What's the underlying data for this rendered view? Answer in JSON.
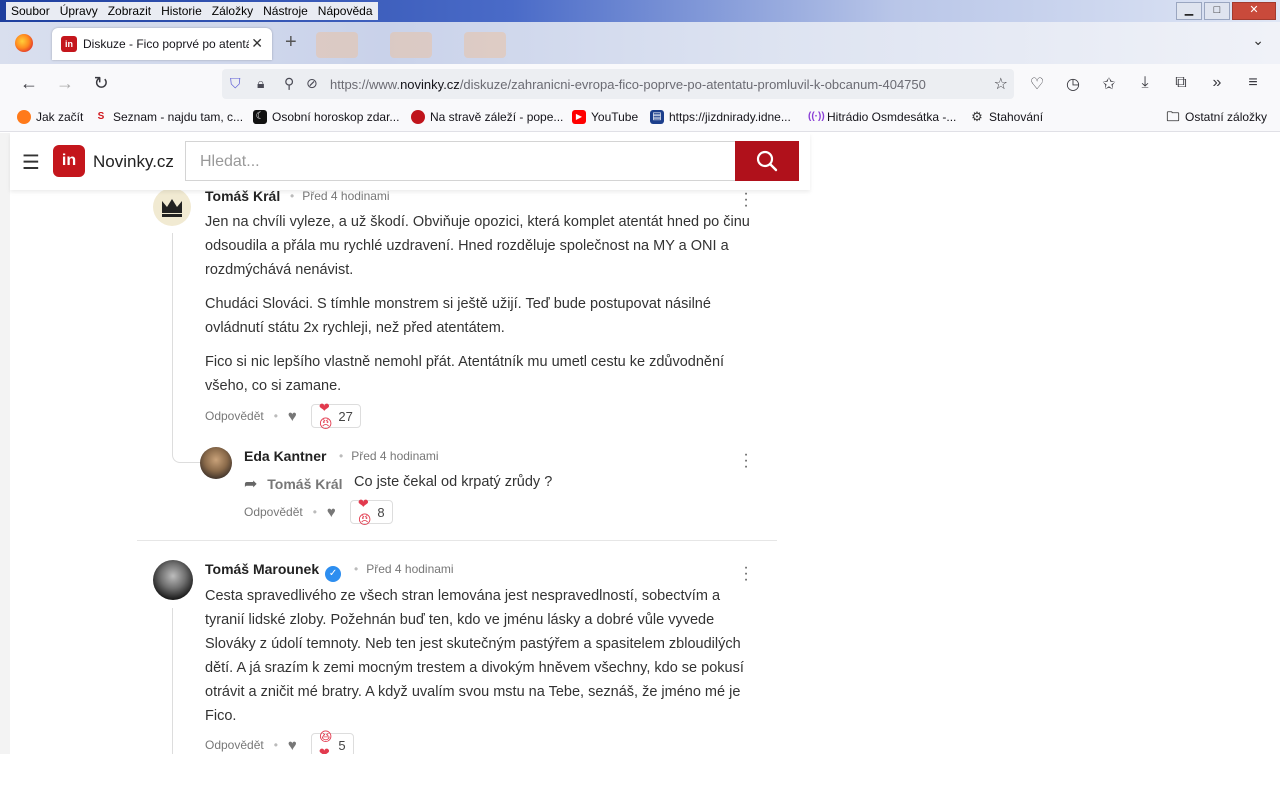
{
  "browser": {
    "menu": [
      "Soubor",
      "Úpravy",
      "Zobrazit",
      "Historie",
      "Záložky",
      "Nástroje",
      "Nápověda"
    ],
    "tab": {
      "title": "Diskuze - Fico poprvé po atentátu"
    },
    "url": {
      "prefix": "https://www.",
      "host": "novinky.cz",
      "path": "/diskuze/zahranicni-evropa-fico-poprve-po-atentatu-promluvil-k-obcanum-404750"
    },
    "bookmarks": [
      {
        "label": "Jak začít"
      },
      {
        "label": "Seznam - najdu tam, c..."
      },
      {
        "label": "Osobní horoskop zdar..."
      },
      {
        "label": "Na stravě záleží - pope..."
      },
      {
        "label": "YouTube"
      },
      {
        "label": "https://jizdnirady.idne..."
      },
      {
        "label": "Hitrádio Osmdesátka -..."
      },
      {
        "label": "Stahování"
      },
      {
        "label": "Ostatní záložky"
      }
    ]
  },
  "site": {
    "logo_mark": "in",
    "logo_text": "Novinky.cz",
    "search_placeholder": "Hledat..."
  },
  "comments": [
    {
      "author": "Tomáš Král",
      "time": "Před 4 hodinami",
      "paragraphs": [
        "Jen na chvíli vyleze, a už škodí. Obviňuje opozici, která komplet atentát hned po činu odsoudila a přála mu rychlé uzdravení. Hned rozděluje společnost na MY a ONI a rozdmýchává nenávist.",
        "Chudáci Slováci. S tímhle monstrem si ještě užijí. Teď bude postupovat násilné ovládnutí státu 2x rychleji, než před atentátem.",
        "Fico si nic lepšího vlastně nemohl přát. Atentátník mu umetl cestu ke zdůvodnění všeho, co si zamane."
      ],
      "reply_label": "Odpovědět",
      "reactions": "27"
    },
    {
      "author": "Eda Kantner",
      "time": "Před 4 hodinami",
      "reply_to": "Tomáš Král",
      "text": "Co jste čekal od krpatý zrůdy ?",
      "reply_label": "Odpovědět",
      "reactions": "8"
    },
    {
      "author": "Tomáš Marounek",
      "verified": "✓",
      "time": "Před 4 hodinami",
      "paragraphs": [
        "Cesta spravedlivého ze všech stran lemována jest nespravedlností, sobectvím a tyranií lidské zloby. Požehnán buď ten, kdo ve jménu lásky a dobré vůle vyvede Slováky z údolí temnoty. Neb ten jest skutečným pastýřem a spasitelem zbloudilých dětí. A já srazím k zemi mocným trestem a divokým hněvem všechny, kdo se pokusí otrávit a zničit mé bratry. A když uvalím svou mstu na Tebe, seznáš, že jméno mé je Fico."
      ],
      "reply_label": "Odpovědět",
      "reactions": "5"
    }
  ]
}
